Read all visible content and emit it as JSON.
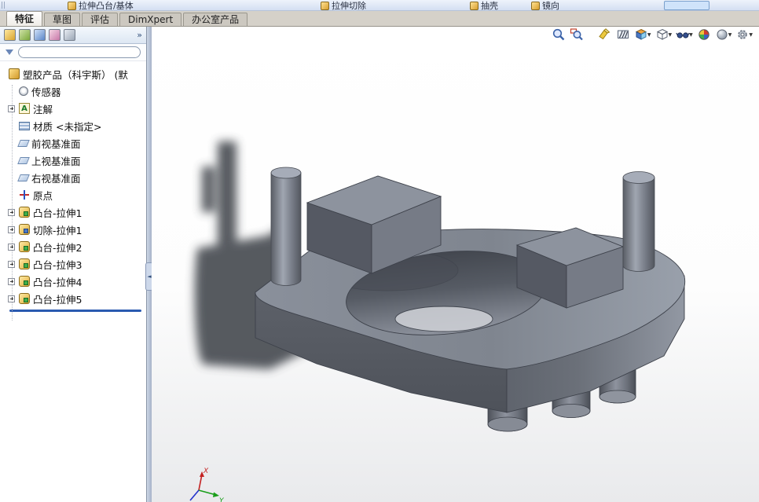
{
  "ribbon": {
    "groups": [
      {
        "label": "拉伸凸台/基体"
      },
      {
        "label": "拉伸切除"
      },
      {
        "label": "抽壳"
      },
      {
        "label": "镜向"
      }
    ],
    "highlight_button_label": ""
  },
  "tabs": [
    {
      "label": "特征",
      "active": true
    },
    {
      "label": "草图",
      "active": false
    },
    {
      "label": "评估",
      "active": false
    },
    {
      "label": "DimXpert",
      "active": false
    },
    {
      "label": "办公室产品",
      "active": false
    }
  ],
  "headsup": {
    "icons": [
      "zoom-fit",
      "zoom-area",
      "flashlight",
      "zebra-stripes",
      "view-orientation",
      "display-style",
      "hide-show-items",
      "edit-appearance",
      "apply-scene",
      "view-settings"
    ]
  },
  "panel": {
    "manager_tabs": [
      "featuremanager",
      "propertymanager",
      "configurationmanager",
      "dimxpertmanager",
      "displaymanager"
    ],
    "overflow_label": "»",
    "filter": {
      "value": "",
      "placeholder": ""
    },
    "tree": [
      {
        "label": "塑胶产品（科宇斯） (默",
        "icon": "part",
        "expandable": false
      },
      {
        "label": "传感器",
        "icon": "sensors",
        "expandable": false
      },
      {
        "label": "注解",
        "icon": "annotations",
        "expandable": true
      },
      {
        "label": "材质 <未指定>",
        "icon": "material",
        "expandable": false
      },
      {
        "label": "前视基准面",
        "icon": "plane",
        "expandable": false
      },
      {
        "label": "上视基准面",
        "icon": "plane",
        "expandable": false
      },
      {
        "label": "右视基准面",
        "icon": "plane",
        "expandable": false
      },
      {
        "label": "原点",
        "icon": "origin",
        "expandable": false
      },
      {
        "label": "凸台-拉伸1",
        "icon": "boss-extrude",
        "expandable": true
      },
      {
        "label": "切除-拉伸1",
        "icon": "cut-extrude",
        "expandable": true
      },
      {
        "label": "凸台-拉伸2",
        "icon": "boss-extrude",
        "expandable": true
      },
      {
        "label": "凸台-拉伸3",
        "icon": "boss-extrude",
        "expandable": true
      },
      {
        "label": "凸台-拉伸4",
        "icon": "boss-extrude",
        "expandable": true
      },
      {
        "label": "凸台-拉伸5",
        "icon": "boss-extrude",
        "expandable": true
      }
    ]
  },
  "triad": {
    "x_label": "X",
    "y_label": "Y"
  },
  "colors": {
    "rollback_blue": "#2a5ab0",
    "model_gray": "#7d828d",
    "viewport_bg": "#ffffff"
  }
}
